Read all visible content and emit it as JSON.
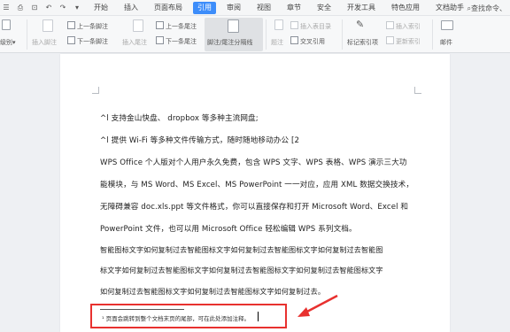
{
  "menu": {
    "tabs": [
      "开始",
      "插入",
      "页面布局",
      "引用",
      "审阅",
      "视图",
      "章节",
      "安全",
      "开发工具",
      "特色应用",
      "文档助手"
    ],
    "active": "引用",
    "search_label": "查找命令、"
  },
  "ribbon": {
    "level_label": "级别",
    "insert_footnote": "插入脚注",
    "prev_footnote": "上一条脚注",
    "next_footnote": "下一条脚注",
    "insert_endnote": "插入尾注",
    "prev_endnote": "上一条尾注",
    "next_endnote": "下一条尾注",
    "separator": "脚注/尾注分隔线",
    "caption": "题注",
    "insert_figure_index": "插入表目录",
    "cross_ref": "交叉引用",
    "mark_index": "标记索引项",
    "insert_index": "插入索引",
    "update_index": "更新索引",
    "mail": "邮件"
  },
  "doc": {
    "lines": [
      "^l 支持金山快盘、 dropbox 等多种主流网盘;",
      "^l 提供 Wi-Fi 等多种文件传输方式，随时随地移动办公 [2",
      "WPS Office 个人版对个人用户永久免费，包含  WPS 文字、WPS 表格、WPS 演示三大功",
      "能模块，与 MS Word、MS Excel、MS PowerPoint 一一对应，应用 XML 数据交换技术，",
      "无障碍兼容 doc.xls.ppt 等文件格式，你可以直接保存和打开  Microsoft Word、Excel 和",
      "PowerPoint  文件，也可以用  Microsoft Office 轻松编辑 WPS 系列文档。",
      "智能图标文字如何复制过去智能图标文字如何复制过去智能图标文字如何复制过去智能图",
      "标文字如何复制过去智能图标文字如何复制过去智能图标文字如何复制过去智能图标文字",
      "如何复制过去智能图标文字如何复制过去智能图标文字如何复制过去。"
    ],
    "footnote": "¹ 页面会跳转到整个文档末页的尾部，可在此处添加注释。"
  },
  "colors": {
    "accent": "#3d8dfa",
    "highlight_box": "#e8312f"
  }
}
